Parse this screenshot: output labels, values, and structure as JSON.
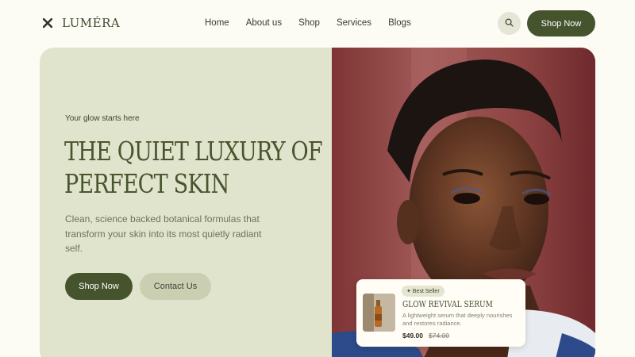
{
  "brand": {
    "name": "LUMÉRA",
    "logo_icon": "x-mark-icon"
  },
  "nav": {
    "items": [
      "Home",
      "About us",
      "Shop",
      "Services",
      "Blogs"
    ]
  },
  "header": {
    "search_icon": "search-icon",
    "shop_label": "Shop Now"
  },
  "hero": {
    "tagline": "Your glow starts here",
    "headline_line1": "THE QUIET LUXURY OF",
    "headline_line2": "PERFECT SKIN",
    "description": "Clean, science backed botanical formulas that transform your skin into its most quietly radiant self.",
    "primary_button": "Shop Now",
    "secondary_button": "Contact Us"
  },
  "product": {
    "badge": "✦ Best Seller",
    "title": "GLOW REVIVAL SERUM",
    "description": "A lightweight serum that deeply nourishes and restores radiance.",
    "price": "$49.00",
    "old_price": "$74.00"
  },
  "colors": {
    "accent": "#46542e",
    "hero_bg": "#e1e4cc",
    "page_bg": "#fcfcf4",
    "photo_bg": "#8a3e3c"
  }
}
